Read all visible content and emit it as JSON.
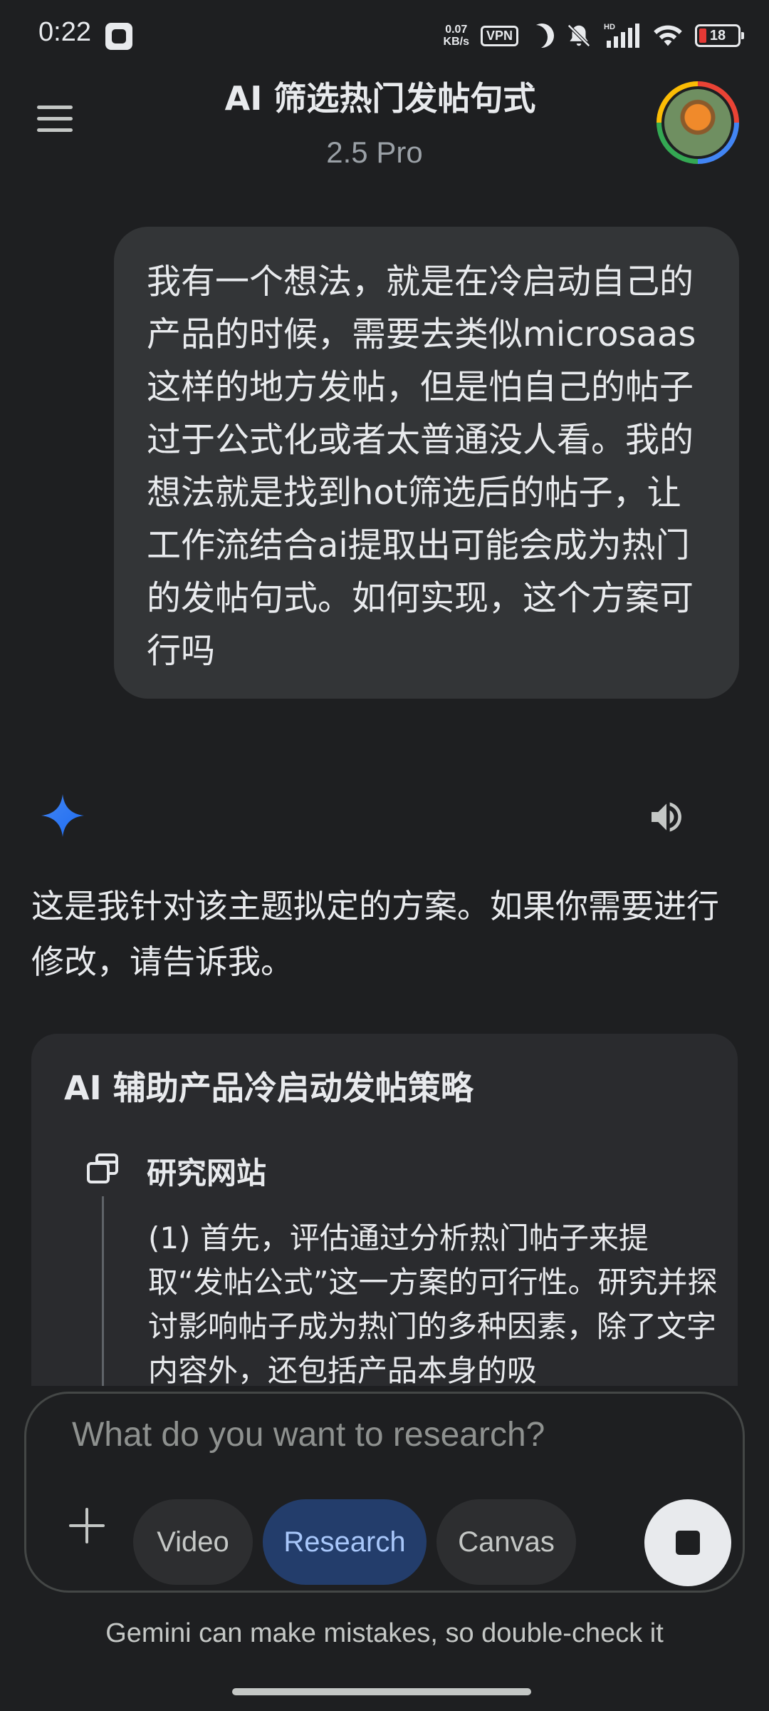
{
  "status_bar": {
    "time": "0:22",
    "net_speed_value": "0.07",
    "net_speed_unit": "KB/s",
    "vpn": "VPN",
    "hd": "HD",
    "battery": "18"
  },
  "header": {
    "title": "AI 筛选热门发帖句式",
    "model": "2.5 Pro"
  },
  "user_message": "我有一个想法，就是在冷启动自己的产品的时候，需要去类似microsaas这样的地方发帖，但是怕自己的帖子过于公式化或者太普通没人看。我的想法就是找到hot筛选后的帖子，让工作流结合ai提取出可能会成为热门的发帖句式。如何实现，这个方案可行吗",
  "response": {
    "intro": "这是我针对该主题拟定的方案。如果你需要进行修改，请告诉我。",
    "plan": {
      "title": "AI 辅助产品冷启动发帖策略",
      "step_label": "研究网站",
      "step_text": "(1) 首先，评估通过分析热门帖子来提取“发帖公式”这一方案的可行性。研究并探讨影响帖子成为热门的多种因素，除了文字内容外，还包括产品本身的吸"
    }
  },
  "composer": {
    "placeholder": "What do you want to research?",
    "chips": {
      "video": "Video",
      "research": "Research",
      "canvas": "Canvas"
    },
    "disclaimer": "Gemini can make mistakes, so double-check it"
  },
  "icons": {
    "menu": "hamburger-menu-icon",
    "model_avatar": "gemini-sparkle-icon",
    "speaker": "speaker-icon",
    "step": "browser-windows-icon",
    "plus": "plus-icon",
    "stop": "stop-icon"
  },
  "colors": {
    "background": "#1e1f21",
    "bubble": "#333537",
    "card": "#2a2b2e",
    "research_chip": "#233d6b",
    "research_chip_text": "#a8c7fa",
    "battery_low": "#e53935",
    "gemini_blue": "#4285f4"
  }
}
